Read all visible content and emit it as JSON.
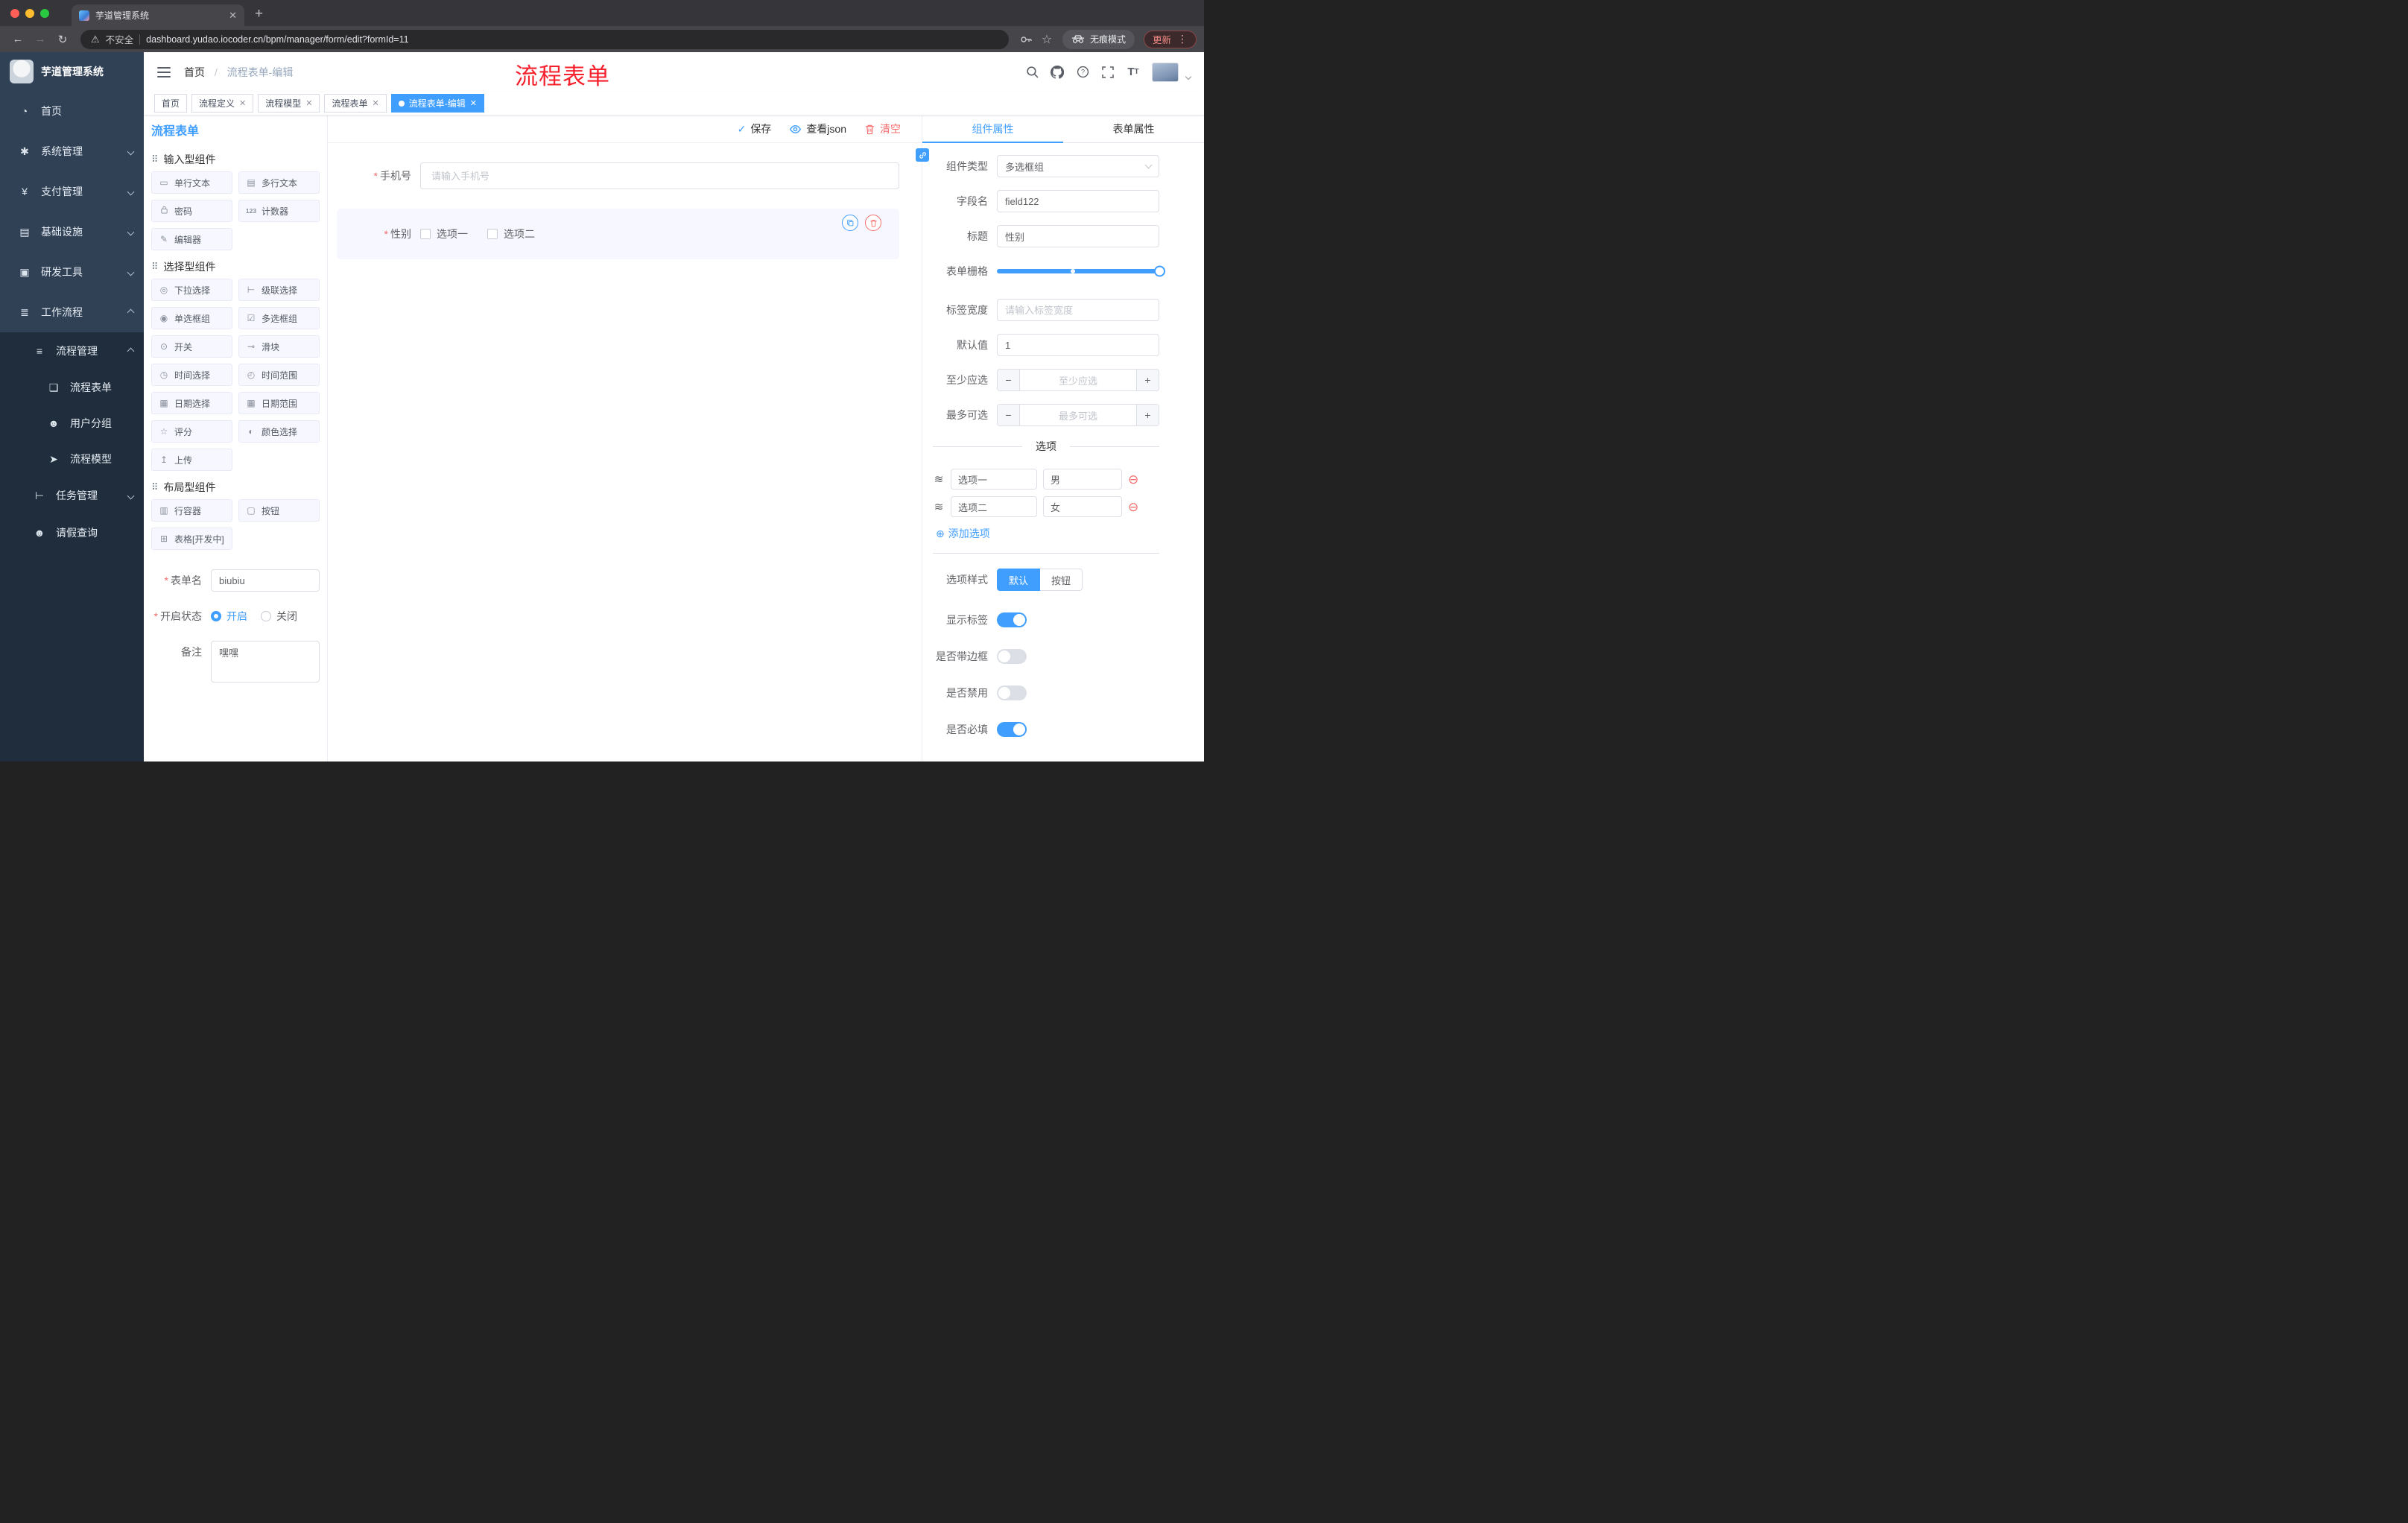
{
  "browser": {
    "tab_title": "芋道管理系统",
    "security": "不安全",
    "url": "dashboard.yudao.iocoder.cn/bpm/manager/form/edit?formId=11",
    "incognito": "无痕模式",
    "update": "更新"
  },
  "sidebar": {
    "logo_title": "芋道管理系统",
    "items": [
      {
        "label": "首页"
      },
      {
        "label": "系统管理"
      },
      {
        "label": "支付管理"
      },
      {
        "label": "基础设施"
      },
      {
        "label": "研发工具"
      },
      {
        "label": "工作流程"
      },
      {
        "label": "流程管理"
      },
      {
        "label": "流程表单"
      },
      {
        "label": "用户分组"
      },
      {
        "label": "流程模型"
      },
      {
        "label": "任务管理"
      },
      {
        "label": "请假查询"
      }
    ]
  },
  "header": {
    "breadcrumb": {
      "home": "首页",
      "current": "流程表单-编辑"
    },
    "overlay_title": "流程表单"
  },
  "tags": [
    {
      "label": "首页",
      "closable": false,
      "active": false
    },
    {
      "label": "流程定义",
      "closable": true,
      "active": false
    },
    {
      "label": "流程模型",
      "closable": true,
      "active": false
    },
    {
      "label": "流程表单",
      "closable": true,
      "active": false
    },
    {
      "label": "流程表单-编辑",
      "closable": true,
      "active": true
    }
  ],
  "designer": {
    "title": "流程表单",
    "actions": {
      "save": "保存",
      "view_json": "查看json",
      "clear": "清空"
    },
    "palette": {
      "sections": [
        {
          "title": "输入型组件",
          "items": [
            "单行文本",
            "多行文本",
            "密码",
            "计数器",
            "编辑器"
          ]
        },
        {
          "title": "选择型组件",
          "items": [
            "下拉选择",
            "级联选择",
            "单选框组",
            "多选框组",
            "开关",
            "滑块",
            "时间选择",
            "时间范围",
            "日期选择",
            "日期范围",
            "评分",
            "颜色选择",
            "上传"
          ]
        },
        {
          "title": "布局型组件",
          "items": [
            "行容器",
            "按钮",
            "表格[开发中]"
          ]
        }
      ]
    },
    "meta": {
      "form_name_label": "表单名",
      "form_name_value": "biubiu",
      "status_label": "开启状态",
      "status_on": "开启",
      "status_off": "关闭",
      "remark_label": "备注",
      "remark_value": "嘿嘿"
    },
    "canvas": {
      "phone_label": "手机号",
      "phone_placeholder": "请输入手机号",
      "gender_label": "性别",
      "gender_options": [
        "选项一",
        "选项二"
      ]
    },
    "props": {
      "tabs": {
        "component": "组件属性",
        "form": "表单属性"
      },
      "component_type_label": "组件类型",
      "component_type_value": "多选框组",
      "field_name_label": "字段名",
      "field_name_value": "field122",
      "title_label": "标题",
      "title_value": "性别",
      "grid_label": "表单栅格",
      "label_width_label": "标签宽度",
      "label_width_placeholder": "请输入标签宽度",
      "default_label": "默认值",
      "default_value": "1",
      "min_label": "至少应选",
      "min_placeholder": "至少应选",
      "max_label": "最多可选",
      "max_placeholder": "最多可选",
      "options_title": "选项",
      "options": [
        {
          "name": "选项一",
          "value": "男"
        },
        {
          "name": "选项二",
          "value": "女"
        }
      ],
      "add_option": "添加选项",
      "style_label": "选项样式",
      "style_default": "默认",
      "style_button": "按钮",
      "toggles": [
        {
          "label": "显示标签",
          "on": true
        },
        {
          "label": "是否带边框",
          "on": false
        },
        {
          "label": "是否禁用",
          "on": false
        },
        {
          "label": "是否必填",
          "on": true
        }
      ]
    }
  },
  "colors": {
    "accent": "#409EFF",
    "danger": "#F56C6C",
    "sidebar": "#304156",
    "submenu": "#1F2D3D",
    "overlay_red": "#F5222D"
  },
  "icons": {
    "save": "check",
    "view_json": "eye",
    "clear": "trash",
    "copy": "copy",
    "delete": "trash",
    "add_option": "plus-circle",
    "remove_option": "minus-circle"
  }
}
